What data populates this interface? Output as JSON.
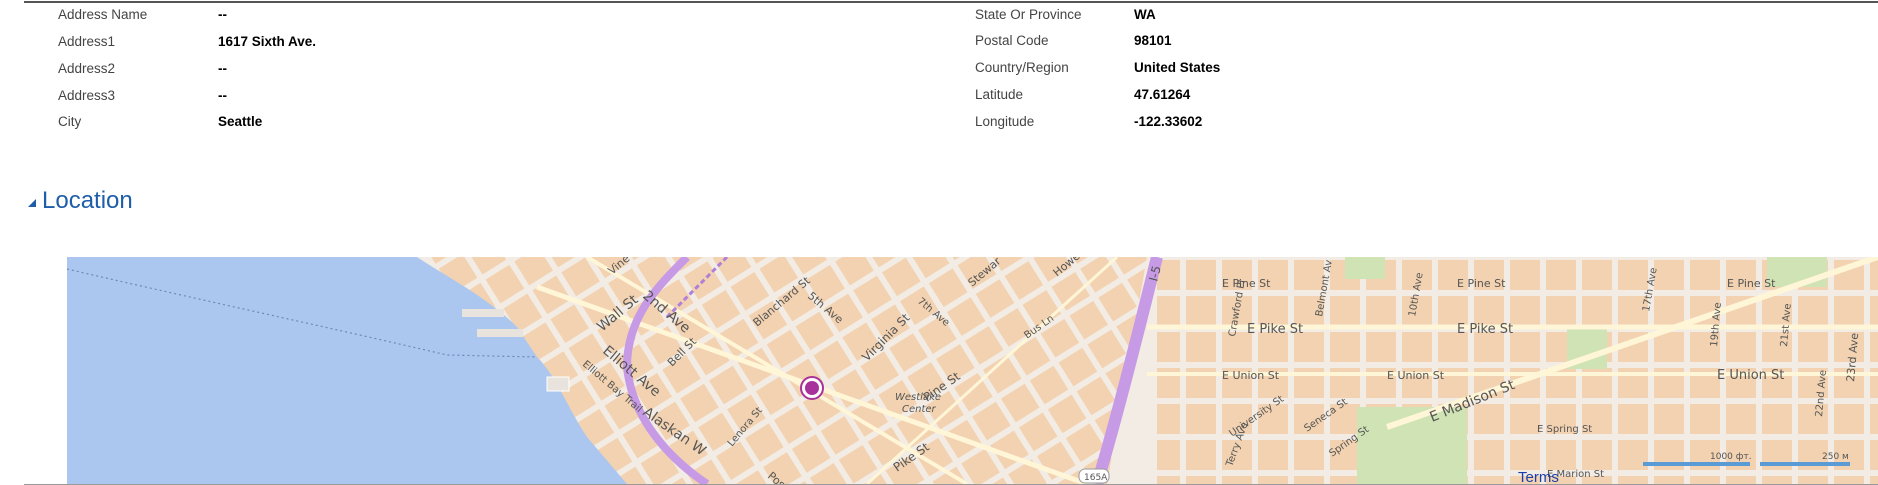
{
  "address_fields_left": [
    {
      "label": "Address Name",
      "value": "--"
    },
    {
      "label": "Address1",
      "value": "1617 Sixth Ave."
    },
    {
      "label": "Address2",
      "value": "--"
    },
    {
      "label": "Address3",
      "value": "--"
    },
    {
      "label": "City",
      "value": "Seattle"
    }
  ],
  "address_fields_right": [
    {
      "label": "State Or Province",
      "value": "WA"
    },
    {
      "label": "Postal Code",
      "value": "98101"
    },
    {
      "label": "Country/Region",
      "value": "United States"
    },
    {
      "label": "Latitude",
      "value": "47.61264"
    },
    {
      "label": "Longitude",
      "value": "-122.33602"
    }
  ],
  "location_section": {
    "title": "Location",
    "map": {
      "water_color": "#abc7f0",
      "land_color": "#f2ece4",
      "block_color": "#f2d2b0",
      "highway_color": "#c79ae6",
      "park_color": "#cfe3b4",
      "pin_color": "#a8329c",
      "labels": {
        "vine": "Vine",
        "wall_st": "Wall St",
        "second_ave": "2nd Ave",
        "blanchard_st": "Blanchard St",
        "fifth_ave": "5th Ave",
        "seventh_ave": "7th Ave",
        "stewart": "Stewar",
        "howell": "Howe",
        "bus_ln": "Bus Ln",
        "i5": "I-5",
        "virginia_st": "Virginia St",
        "bell_st": "Bell St",
        "elliott_ave": "Elliott Ave",
        "elliott_bay_trail": "Elliott Bay Trail",
        "alaskan": "Alaskan W",
        "lenora_st": "Lenora St",
        "westlake_center": "Westlake\nCenter",
        "westlake": "Westlake",
        "center": "Center",
        "pine_st": "Pine St",
        "pike_st": "Pike St",
        "post": "Post",
        "e_pine_st_1": "E Pine St",
        "e_pine_st_2": "E Pine St",
        "e_pine_st_3": "E Pine St",
        "e_pike_st_1": "E Pike St",
        "e_pike_st_2": "E Pike St",
        "e_union_st_1": "E Union St",
        "e_union_st_2": "E Union St",
        "e_union_st_3": "E Union St",
        "crawford_pl": "Crawford Pl",
        "belmont_av": "Belmont Av",
        "tenth_ave": "10th Ave",
        "seventeenth_ave": "17th Ave",
        "nineteenth_ave": "19th Ave",
        "twenty_first_ave": "21st Ave",
        "twenty_second_ave": "22nd Ave",
        "twenty_third_ave": "23rd Ave",
        "e_madison_st": "E Madison St",
        "university_st": "University St",
        "seneca_st": "Seneca St",
        "spring_st": "Spring St",
        "e_spring_st": "E Spring St",
        "e_marion_st": "E Marion St",
        "terry_ave": "Terry Ave",
        "route_165a": "165A",
        "scale_ft": "1000 фт.",
        "scale_m": "250 м",
        "terms": "Terms"
      }
    }
  }
}
